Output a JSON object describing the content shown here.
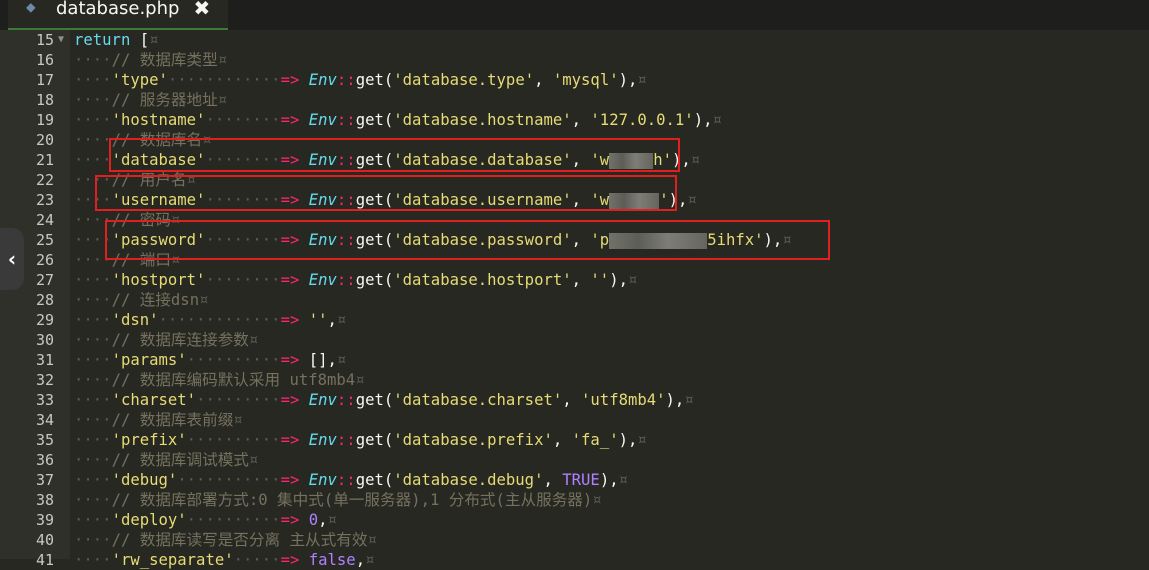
{
  "tab": {
    "filename": "database.php",
    "close_glyph": "✖"
  },
  "side_toggle": {
    "glyph": "‹"
  },
  "colors": {
    "highlight_box": "#e02020",
    "keyword": "#66d9ef",
    "string": "#e6db74",
    "operator": "#f92672",
    "comment": "#75715e",
    "number": "#ae81ff"
  },
  "editor": {
    "line_numbers": [
      "15",
      "16",
      "17",
      "18",
      "19",
      "20",
      "21",
      "22",
      "23",
      "24",
      "25",
      "26",
      "27",
      "28",
      "29",
      "30",
      "31",
      "32",
      "33",
      "34",
      "35",
      "36",
      "37",
      "38",
      "39",
      "40",
      "41"
    ],
    "lines": [
      {
        "indent": "",
        "parts": [
          {
            "c": "kw",
            "t": "return"
          },
          {
            "c": "pl",
            "t": " ["
          }
        ]
      },
      {
        "indent": "····",
        "parts": [
          {
            "c": "cm",
            "t": "// 数据库类型"
          }
        ]
      },
      {
        "indent": "····",
        "parts": [
          {
            "c": "st",
            "t": "'type'"
          },
          {
            "c": "ws",
            "t": "············"
          },
          {
            "c": "op",
            "t": "=>"
          },
          {
            "c": "pl",
            "t": " "
          },
          {
            "c": "cls",
            "t": "Env"
          },
          {
            "c": "op",
            "t": "::"
          },
          {
            "c": "pl",
            "t": "get("
          },
          {
            "c": "st",
            "t": "'database.type'"
          },
          {
            "c": "pl",
            "t": ", "
          },
          {
            "c": "st",
            "t": "'mysql'"
          },
          {
            "c": "pl",
            "t": "),"
          }
        ]
      },
      {
        "indent": "····",
        "parts": [
          {
            "c": "cm",
            "t": "// 服务器地址"
          }
        ]
      },
      {
        "indent": "····",
        "parts": [
          {
            "c": "st",
            "t": "'hostname'"
          },
          {
            "c": "ws",
            "t": "········"
          },
          {
            "c": "op",
            "t": "=>"
          },
          {
            "c": "pl",
            "t": " "
          },
          {
            "c": "cls",
            "t": "Env"
          },
          {
            "c": "op",
            "t": "::"
          },
          {
            "c": "pl",
            "t": "get("
          },
          {
            "c": "st",
            "t": "'database.hostname'"
          },
          {
            "c": "pl",
            "t": ", "
          },
          {
            "c": "st",
            "t": "'127.0.0.1'"
          },
          {
            "c": "pl",
            "t": "),"
          }
        ]
      },
      {
        "indent": "····",
        "parts": [
          {
            "c": "cm",
            "t": "// 数据库名"
          }
        ]
      },
      {
        "indent": "····",
        "parts": [
          {
            "c": "st",
            "t": "'database'"
          },
          {
            "c": "ws",
            "t": "········"
          },
          {
            "c": "op",
            "t": "=>"
          },
          {
            "c": "pl",
            "t": " "
          },
          {
            "c": "cls",
            "t": "Env"
          },
          {
            "c": "op",
            "t": "::"
          },
          {
            "c": "pl",
            "t": "get("
          },
          {
            "c": "st",
            "t": "'database.database'"
          },
          {
            "c": "pl",
            "t": ", "
          },
          {
            "c": "st",
            "t": "'w"
          },
          {
            "c": "blur",
            "w": 44
          },
          {
            "c": "st",
            "t": "h'"
          },
          {
            "c": "pl",
            "t": "),"
          }
        ]
      },
      {
        "indent": "····",
        "parts": [
          {
            "c": "cm",
            "t": "// 用户名"
          }
        ]
      },
      {
        "indent": "····",
        "parts": [
          {
            "c": "st",
            "t": "'username'"
          },
          {
            "c": "ws",
            "t": "········"
          },
          {
            "c": "op",
            "t": "=>"
          },
          {
            "c": "pl",
            "t": " "
          },
          {
            "c": "cls",
            "t": "Env"
          },
          {
            "c": "op",
            "t": "::"
          },
          {
            "c": "pl",
            "t": "get("
          },
          {
            "c": "st",
            "t": "'database.username'"
          },
          {
            "c": "pl",
            "t": ", "
          },
          {
            "c": "st",
            "t": "'w"
          },
          {
            "c": "blur",
            "w": 50
          },
          {
            "c": "st",
            "t": "'"
          },
          {
            "c": "pl",
            "t": "),"
          }
        ]
      },
      {
        "indent": "····",
        "parts": [
          {
            "c": "cm",
            "t": "// 密码"
          }
        ]
      },
      {
        "indent": "····",
        "parts": [
          {
            "c": "st",
            "t": "'password'"
          },
          {
            "c": "ws",
            "t": "········"
          },
          {
            "c": "op",
            "t": "=>"
          },
          {
            "c": "pl",
            "t": " "
          },
          {
            "c": "cls",
            "t": "Env"
          },
          {
            "c": "op",
            "t": "::"
          },
          {
            "c": "pl",
            "t": "get("
          },
          {
            "c": "st",
            "t": "'database.password'"
          },
          {
            "c": "pl",
            "t": ", "
          },
          {
            "c": "st",
            "t": "'p"
          },
          {
            "c": "blur",
            "w": 98
          },
          {
            "c": "st",
            "t": "5ihfx'"
          },
          {
            "c": "pl",
            "t": "),"
          }
        ]
      },
      {
        "indent": "····",
        "parts": [
          {
            "c": "cm",
            "t": "// 端口"
          }
        ]
      },
      {
        "indent": "····",
        "parts": [
          {
            "c": "st",
            "t": "'hostport'"
          },
          {
            "c": "ws",
            "t": "········"
          },
          {
            "c": "op",
            "t": "=>"
          },
          {
            "c": "pl",
            "t": " "
          },
          {
            "c": "cls",
            "t": "Env"
          },
          {
            "c": "op",
            "t": "::"
          },
          {
            "c": "pl",
            "t": "get("
          },
          {
            "c": "st",
            "t": "'database.hostport'"
          },
          {
            "c": "pl",
            "t": ", "
          },
          {
            "c": "st",
            "t": "''"
          },
          {
            "c": "pl",
            "t": "),"
          }
        ]
      },
      {
        "indent": "····",
        "parts": [
          {
            "c": "cm",
            "t": "// 连接dsn"
          }
        ]
      },
      {
        "indent": "····",
        "parts": [
          {
            "c": "st",
            "t": "'dsn'"
          },
          {
            "c": "ws",
            "t": "·············"
          },
          {
            "c": "op",
            "t": "=>"
          },
          {
            "c": "pl",
            "t": " "
          },
          {
            "c": "st",
            "t": "''"
          },
          {
            "c": "pl",
            "t": ","
          }
        ]
      },
      {
        "indent": "····",
        "parts": [
          {
            "c": "cm",
            "t": "// 数据库连接参数"
          }
        ]
      },
      {
        "indent": "····",
        "parts": [
          {
            "c": "st",
            "t": "'params'"
          },
          {
            "c": "ws",
            "t": "··········"
          },
          {
            "c": "op",
            "t": "=>"
          },
          {
            "c": "pl",
            "t": " [],"
          }
        ]
      },
      {
        "indent": "····",
        "parts": [
          {
            "c": "cm",
            "t": "// 数据库编码默认采用 utf8mb4"
          }
        ]
      },
      {
        "indent": "····",
        "parts": [
          {
            "c": "st",
            "t": "'charset'"
          },
          {
            "c": "ws",
            "t": "·········"
          },
          {
            "c": "op",
            "t": "=>"
          },
          {
            "c": "pl",
            "t": " "
          },
          {
            "c": "cls",
            "t": "Env"
          },
          {
            "c": "op",
            "t": "::"
          },
          {
            "c": "pl",
            "t": "get("
          },
          {
            "c": "st",
            "t": "'database.charset'"
          },
          {
            "c": "pl",
            "t": ", "
          },
          {
            "c": "st",
            "t": "'utf8mb4'"
          },
          {
            "c": "pl",
            "t": "),"
          }
        ]
      },
      {
        "indent": "····",
        "parts": [
          {
            "c": "cm",
            "t": "// 数据库表前缀"
          }
        ]
      },
      {
        "indent": "····",
        "parts": [
          {
            "c": "st",
            "t": "'prefix'"
          },
          {
            "c": "ws",
            "t": "··········"
          },
          {
            "c": "op",
            "t": "=>"
          },
          {
            "c": "pl",
            "t": " "
          },
          {
            "c": "cls",
            "t": "Env"
          },
          {
            "c": "op",
            "t": "::"
          },
          {
            "c": "pl",
            "t": "get("
          },
          {
            "c": "st",
            "t": "'database.prefix'"
          },
          {
            "c": "pl",
            "t": ", "
          },
          {
            "c": "st",
            "t": "'fa_'"
          },
          {
            "c": "pl",
            "t": "),"
          }
        ]
      },
      {
        "indent": "····",
        "parts": [
          {
            "c": "cm",
            "t": "// 数据库调试模式"
          }
        ]
      },
      {
        "indent": "····",
        "parts": [
          {
            "c": "st",
            "t": "'debug'"
          },
          {
            "c": "ws",
            "t": "···········"
          },
          {
            "c": "op",
            "t": "=>"
          },
          {
            "c": "pl",
            "t": " "
          },
          {
            "c": "cls",
            "t": "Env"
          },
          {
            "c": "op",
            "t": "::"
          },
          {
            "c": "pl",
            "t": "get("
          },
          {
            "c": "st",
            "t": "'database.debug'"
          },
          {
            "c": "pl",
            "t": ", "
          },
          {
            "c": "cn",
            "t": "TRUE"
          },
          {
            "c": "pl",
            "t": "),"
          }
        ]
      },
      {
        "indent": "····",
        "parts": [
          {
            "c": "cm",
            "t": "// 数据库部署方式:0 集中式(单一服务器),1 分布式(主从服务器)"
          }
        ]
      },
      {
        "indent": "····",
        "parts": [
          {
            "c": "st",
            "t": "'deploy'"
          },
          {
            "c": "ws",
            "t": "··········"
          },
          {
            "c": "op",
            "t": "=>"
          },
          {
            "c": "pl",
            "t": " "
          },
          {
            "c": "nm",
            "t": "0"
          },
          {
            "c": "pl",
            "t": ","
          }
        ]
      },
      {
        "indent": "····",
        "parts": [
          {
            "c": "cm",
            "t": "// 数据库读写是否分离 主从式有效"
          }
        ]
      },
      {
        "indent": "····",
        "parts": [
          {
            "c": "st",
            "t": "'rw_separate'"
          },
          {
            "c": "ws",
            "t": "·····"
          },
          {
            "c": "op",
            "t": "=>"
          },
          {
            "c": "pl",
            "t": " "
          },
          {
            "c": "cn",
            "t": "false"
          },
          {
            "c": "pl",
            "t": ","
          }
        ]
      }
    ],
    "eol_marker": "¤"
  }
}
